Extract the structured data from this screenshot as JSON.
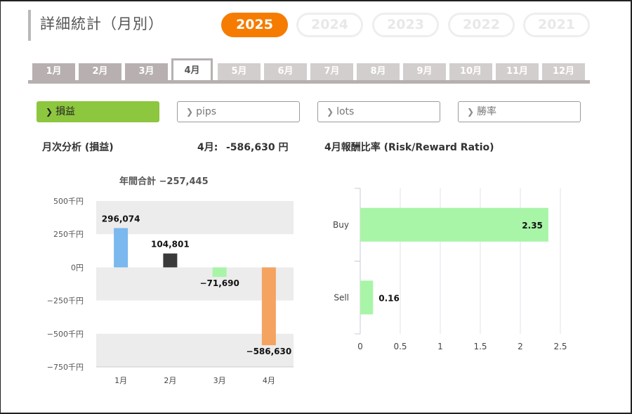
{
  "header": {
    "title": "詳細統計（月別）"
  },
  "years": [
    "2025",
    "2024",
    "2023",
    "2022",
    "2021"
  ],
  "active_year": "2025",
  "months": [
    "1月",
    "2月",
    "3月",
    "4月",
    "5月",
    "6月",
    "7月",
    "8月",
    "9月",
    "10月",
    "11月",
    "12月"
  ],
  "active_month_index": 3,
  "metrics": [
    {
      "label": "損益"
    },
    {
      "label": "pips"
    },
    {
      "label": "lots"
    },
    {
      "label": "勝率"
    }
  ],
  "analysis": {
    "title": "月次分析 (損益)",
    "month_total_label": "4月:",
    "month_total_value": "-586,630 円",
    "ratio_title": "4月報酬比率 (Risk/Reward Ratio)"
  },
  "colors": {
    "accent": "#f57c00",
    "green": "#8dc63f",
    "blue": "#7ab8ee",
    "dark": "#3a3a3a",
    "lightgreen": "#a8f5a8",
    "orange": "#f4a460"
  },
  "chart_data": [
    {
      "type": "bar",
      "title": "年間合計 −257,445",
      "categories": [
        "1月",
        "2月",
        "3月",
        "4月"
      ],
      "values": [
        296074,
        104801,
        -71690,
        -586630
      ],
      "value_labels": [
        "296,074",
        "104,801",
        "−71,690",
        "−586,630"
      ],
      "bar_colors": [
        "#7ab8ee",
        "#3a3a3a",
        "#a8f5a8",
        "#f4a460"
      ],
      "yticks": [
        500000,
        250000,
        0,
        -250000,
        -500000,
        -750000
      ],
      "ytick_labels": [
        "500千円",
        "250千円",
        "0円",
        "−250千円",
        "−500千円",
        "−750千円"
      ],
      "ylim": [
        -750000,
        500000
      ]
    },
    {
      "type": "bar",
      "orientation": "horizontal",
      "categories": [
        "Buy",
        "Sell"
      ],
      "values": [
        2.35,
        0.16
      ],
      "value_labels": [
        "2.35",
        "0.16"
      ],
      "xticks": [
        0,
        0.5,
        1,
        1.5,
        2,
        2.5
      ],
      "xtick_labels": [
        "0",
        "0.5",
        "1",
        "1.5",
        "2",
        "2.5"
      ],
      "xlim": [
        0,
        2.5
      ]
    }
  ]
}
